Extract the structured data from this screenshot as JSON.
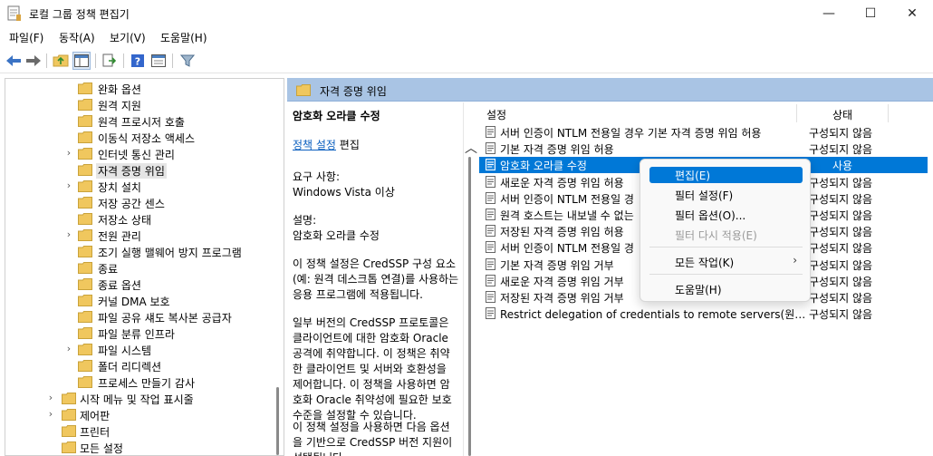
{
  "window": {
    "title": "로컬 그룹 정책 편집기",
    "minimize": "—",
    "maximize": "☐",
    "close": "✕"
  },
  "menu": [
    "파일(F)",
    "동작(A)",
    "보기(V)",
    "도움말(H)"
  ],
  "tree": {
    "items": [
      {
        "label": "완화 옵션",
        "expandable": false
      },
      {
        "label": "원격 지원",
        "expandable": false
      },
      {
        "label": "원격 프로시저 호출",
        "expandable": false
      },
      {
        "label": "이동식 저장소 액세스",
        "expandable": false
      },
      {
        "label": "인터넷 통신 관리",
        "expandable": true
      },
      {
        "label": "자격 증명 위임",
        "expandable": false,
        "selected": true
      },
      {
        "label": "장치 설치",
        "expandable": true
      },
      {
        "label": "저장 공간 센스",
        "expandable": false
      },
      {
        "label": "저장소 상태",
        "expandable": false
      },
      {
        "label": "전원 관리",
        "expandable": true
      },
      {
        "label": "조기 실행 맬웨어 방지 프로그램",
        "expandable": false
      },
      {
        "label": "종료",
        "expandable": false
      },
      {
        "label": "종료 옵션",
        "expandable": false
      },
      {
        "label": "커널 DMA 보호",
        "expandable": false
      },
      {
        "label": "파일 공유 섀도 복사본 공급자",
        "expandable": false
      },
      {
        "label": "파일 분류 인프라",
        "expandable": false
      },
      {
        "label": "파일 시스템",
        "expandable": true
      },
      {
        "label": "폴더 리디렉션",
        "expandable": false
      },
      {
        "label": "프로세스 만들기 감사",
        "expandable": false
      },
      {
        "label": "시작 메뉴 및 작업 표시줄",
        "expandable": true,
        "level": 1
      },
      {
        "label": "제어판",
        "expandable": true,
        "level": 1
      },
      {
        "label": "프린터",
        "expandable": false,
        "level": 1
      },
      {
        "label": "모든 설정",
        "expandable": false,
        "level": 1
      }
    ]
  },
  "header": {
    "title": "자격 증명 위임"
  },
  "description": {
    "title": "암호화 오라클 수정",
    "link": "정책 설정",
    "link_suffix": " 편집",
    "req_label": "요구 사항:",
    "req_value": "Windows Vista 이상",
    "desc_label": "설명:",
    "desc_value": "암호화 오라클 수정",
    "para1": "이 정책 설정은 CredSSP 구성 요소(예: 원격 데스크톱 연결)를 사용하는 응용 프로그램에 적용됩니다.",
    "para2": "일부 버전의 CredSSP 프로토콜은 클라이언트에 대한 암호화 Oracle 공격에 취약합니다.  이 정책은 취약한 클라이언트 및 서버와 호환성을 제어합니다.  이 정책을 사용하면 암호화 Oracle 취약성에 필요한 보호 수준을 설정할 수 있습니다.",
    "para3": "이 정책 설정을 사용하면 다음 옵션을 기반으로 CredSSP 버전 지원이 선택됩니다."
  },
  "list": {
    "col_setting": "설정",
    "col_state": "상태",
    "rows": [
      {
        "name": "서버 인증이 NTLM 전용일 경우 기본 자격 증명 위임 허용",
        "state": "구성되지 않음"
      },
      {
        "name": "기본 자격 증명 위임 허용",
        "state": "구성되지 않음"
      },
      {
        "name": "암호화 오라클 수정",
        "state": "사용",
        "selected": true
      },
      {
        "name": "새로운 자격 증명 위임 허용",
        "state": "구성되지 않음"
      },
      {
        "name": "서버 인증이 NTLM 전용일 경",
        "state": "구성되지 않음"
      },
      {
        "name": "원격 호스트는 내보낼 수 없는",
        "state": "구성되지 않음"
      },
      {
        "name": "저장된 자격 증명 위임 허용",
        "state": "구성되지 않음"
      },
      {
        "name": "서버 인증이 NTLM 전용일 경",
        "state": "구성되지 않음"
      },
      {
        "name": "기본 자격 증명 위임 거부",
        "state": "구성되지 않음"
      },
      {
        "name": "새로운 자격 증명 위임 거부",
        "state": "구성되지 않음"
      },
      {
        "name": "저장된 자격 증명 위임 거부",
        "state": "구성되지 않음"
      },
      {
        "name": "Restrict delegation of credentials to remote servers(원격 서...",
        "state": "구성되지 않음"
      }
    ]
  },
  "context_menu": {
    "items": [
      {
        "label": "편집(E)",
        "highlighted": true
      },
      {
        "label": "필터 설정(F)"
      },
      {
        "label": "필터 옵션(O)..."
      },
      {
        "label": "필터 다시 적용(E)",
        "disabled": true
      },
      {
        "label": "모든 작업(K)",
        "submenu": true
      },
      {
        "label": "도움말(H)"
      }
    ]
  },
  "colors": {
    "header_bg": "#a9c4e4",
    "selection": "#0078d7",
    "folder": "#f0c75e"
  }
}
